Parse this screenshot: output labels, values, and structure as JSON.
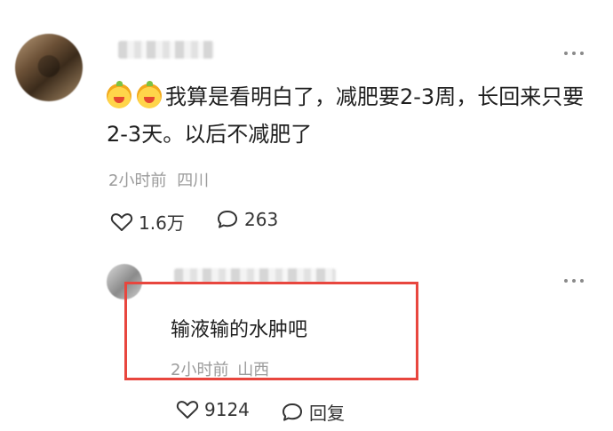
{
  "comment": {
    "text": "我算是看明白了，减肥要2-3周，长回来只要2-3天。以后不减肥了",
    "time": "2小时前",
    "location": "四川",
    "likes": "1.6万",
    "replies": "263"
  },
  "reply": {
    "text": "输液输的水肿吧",
    "time": "2小时前",
    "location": "山西",
    "likes": "9124",
    "reply_label": "回复"
  },
  "colors": {
    "highlight": "#e8463e",
    "meta_text": "#9b9b9b"
  },
  "icons": [
    "heart-icon",
    "comment-bubble-icon",
    "more-dots-icon",
    "emoji-icon"
  ]
}
